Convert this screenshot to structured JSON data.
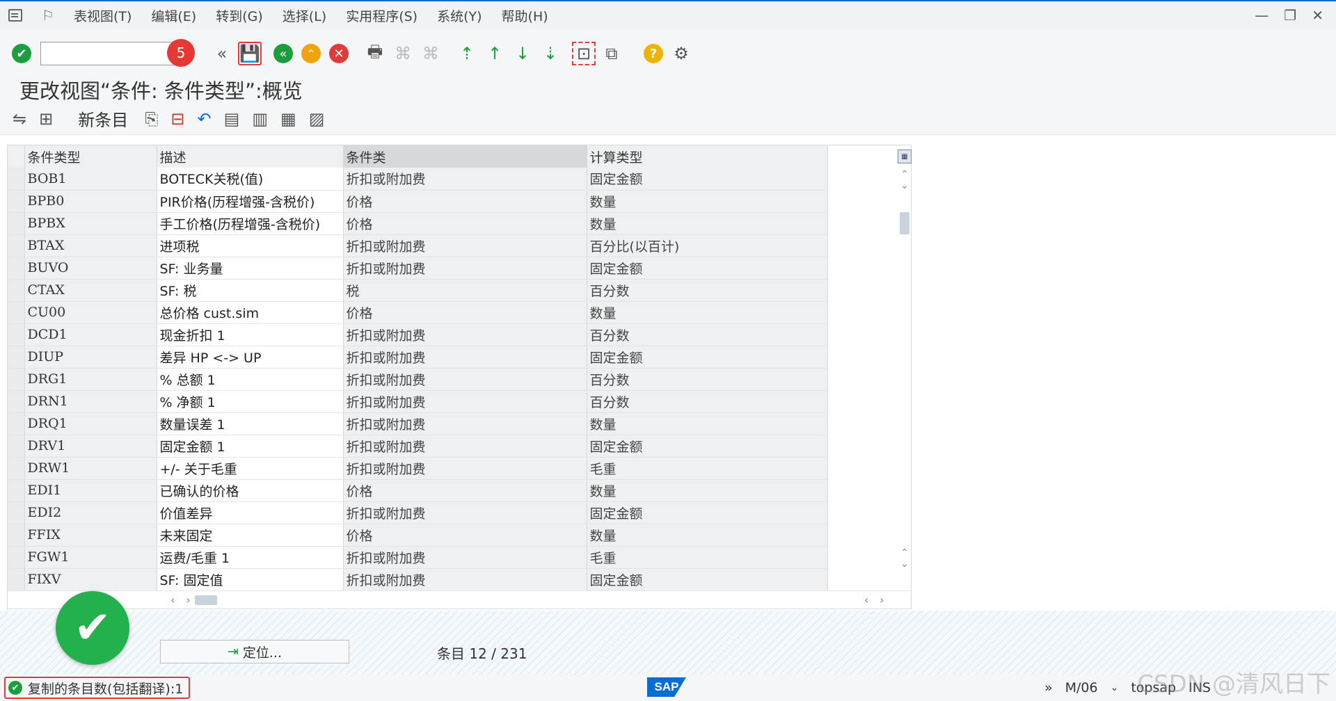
{
  "menu": {
    "items": [
      "表视图(T)",
      "编辑(E)",
      "转到(G)",
      "选择(L)",
      "实用程序(S)",
      "系统(Y)",
      "帮助(H)"
    ]
  },
  "toolbar": {
    "command_value": "",
    "badge": "5"
  },
  "page_title": "更改视图“条件: 条件类型”:概览",
  "app_toolbar": {
    "new_entries_label": "新条目"
  },
  "table": {
    "headers": [
      "条件类型",
      "描述",
      "条件类",
      "计算类型"
    ],
    "rows": [
      [
        "BOB1",
        "BOTECK关税(值)",
        "折扣或附加费",
        "固定金额"
      ],
      [
        "BPB0",
        "PIR价格(历程增强-含税价)",
        "价格",
        "数量"
      ],
      [
        "BPBX",
        "手工价格(历程增强-含税价)",
        "价格",
        "数量"
      ],
      [
        "BTAX",
        "进项税",
        "折扣或附加费",
        "百分比(以百计)"
      ],
      [
        "BUVO",
        "SF: 业务量",
        "折扣或附加费",
        "固定金额"
      ],
      [
        "CTAX",
        "SF: 税",
        "税",
        "百分数"
      ],
      [
        "CU00",
        "总价格 cust.sim",
        "价格",
        "数量"
      ],
      [
        "DCD1",
        "现金折扣 1",
        "折扣或附加费",
        "百分数"
      ],
      [
        "DIUP",
        "差异 HP <-> UP",
        "折扣或附加费",
        "固定金额"
      ],
      [
        "DRG1",
        "% 总额 1",
        "折扣或附加费",
        "百分数"
      ],
      [
        "DRN1",
        "% 净额 1",
        "折扣或附加费",
        "百分数"
      ],
      [
        "DRQ1",
        "数量误差 1",
        "折扣或附加费",
        "数量"
      ],
      [
        "DRV1",
        "固定金额 1",
        "折扣或附加费",
        "固定金额"
      ],
      [
        "DRW1",
        "+/- 关于毛重",
        "折扣或附加费",
        "毛重"
      ],
      [
        "EDI1",
        "已确认的价格",
        "价格",
        "数量"
      ],
      [
        "EDI2",
        "价值差异",
        "折扣或附加费",
        "固定金额"
      ],
      [
        "FFIX",
        "未来固定",
        "价格",
        "数量"
      ],
      [
        "FGW1",
        "运费/毛重 1",
        "折扣或附加费",
        "毛重"
      ],
      [
        "FIXV",
        "SF: 固定值",
        "折扣或附加费",
        "固定金额"
      ]
    ]
  },
  "locate_button": "定位...",
  "entry_info": "条目 12 / 231",
  "status": {
    "message": "复制的条目数(包括翻译):1",
    "sap_logo": "SAP",
    "session": "M/06",
    "system": "topsap",
    "mode": "INS"
  },
  "watermark": "CSDN @清风日下",
  "colors": {
    "accent": "#0a6ed1",
    "highlight": "#e53935",
    "success": "#1b9e3e"
  }
}
